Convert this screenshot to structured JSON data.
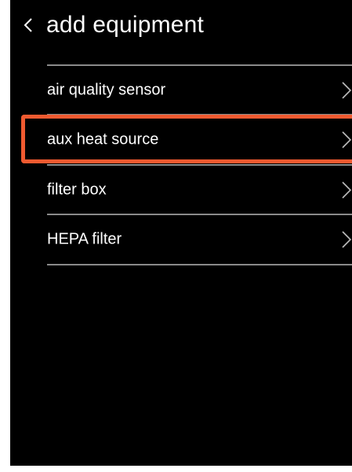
{
  "header": {
    "title": "add equipment",
    "back_icon": "chevron-left-icon"
  },
  "equipment_list": {
    "items": [
      {
        "label": "air quality sensor",
        "icon": "chevron-right-icon",
        "highlighted": false
      },
      {
        "label": "aux heat source",
        "icon": "chevron-right-icon",
        "highlighted": true
      },
      {
        "label": "filter box",
        "icon": "chevron-right-icon",
        "highlighted": false
      },
      {
        "label": "HEPA filter",
        "icon": "chevron-right-icon",
        "highlighted": false
      }
    ]
  },
  "colors": {
    "background": "#000000",
    "text": "#ffffff",
    "divider": "#8a8a8a",
    "highlight": "#f05a30"
  }
}
